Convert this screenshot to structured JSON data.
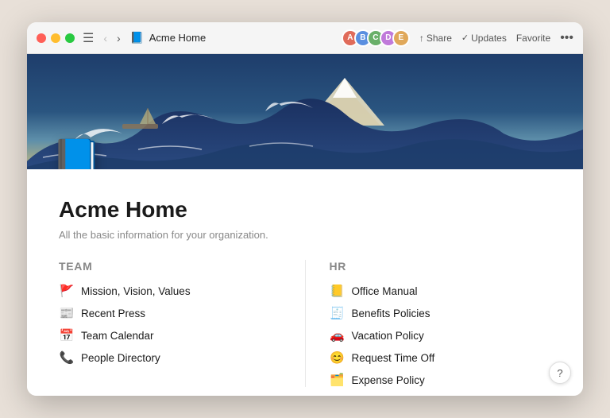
{
  "titlebar": {
    "title": "Acme Home",
    "share_label": "Share",
    "updates_label": "Updates",
    "favorite_label": "Favorite",
    "more_icon": "•••"
  },
  "avatars": [
    {
      "color": "#e06b5a",
      "initial": "A"
    },
    {
      "color": "#5a8fe0",
      "initial": "B"
    },
    {
      "color": "#6ab06a",
      "initial": "C"
    },
    {
      "color": "#c07ada",
      "initial": "D"
    },
    {
      "color": "#e0a85a",
      "initial": "E"
    }
  ],
  "page": {
    "title": "Acme Home",
    "subtitle": "All the basic information for your organization."
  },
  "sections": [
    {
      "id": "team",
      "title": "Team",
      "items": [
        {
          "emoji": "🚩",
          "label": "Mission, Vision, Values"
        },
        {
          "emoji": "📰",
          "label": "Recent Press"
        },
        {
          "emoji": "📅",
          "label": "Team Calendar"
        },
        {
          "emoji": "📞",
          "label": "People Directory"
        }
      ]
    },
    {
      "id": "hr",
      "title": "HR",
      "items": [
        {
          "emoji": "📒",
          "label": "Office Manual"
        },
        {
          "emoji": "🧾",
          "label": "Benefits Policies"
        },
        {
          "emoji": "🚗",
          "label": "Vacation Policy"
        },
        {
          "emoji": "😊",
          "label": "Request Time Off"
        },
        {
          "emoji": "🗂️",
          "label": "Expense Policy"
        }
      ]
    }
  ],
  "help": {
    "label": "?"
  }
}
